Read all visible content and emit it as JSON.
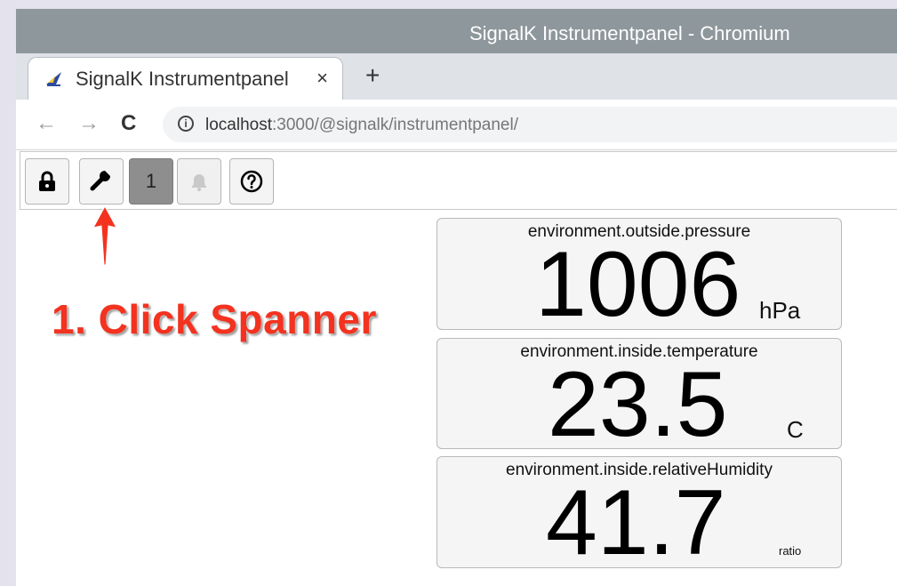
{
  "window": {
    "title": "SignalK Instrumentpanel - Chromium"
  },
  "tab": {
    "title": "SignalK Instrumentpanel",
    "close_label": "×",
    "new_tab_label": "+"
  },
  "nav": {
    "back_label": "←",
    "forward_label": "→",
    "reload_label": "C",
    "url_host": "localhost",
    "url_rest": ":3000/@signalk/instrumentpanel/"
  },
  "toolbar": {
    "counter_label": "1"
  },
  "annotation": {
    "text": "1. Click Spanner",
    "color": "#f3321f"
  },
  "widgets": [
    {
      "path": "environment.outside.pressure",
      "value": "1006",
      "unit": "hPa"
    },
    {
      "path": "environment.inside.temperature",
      "value": "23.5",
      "unit": "C"
    },
    {
      "path": "environment.inside.relativeHumidity",
      "value": "41.7",
      "unit": "ratio"
    }
  ]
}
